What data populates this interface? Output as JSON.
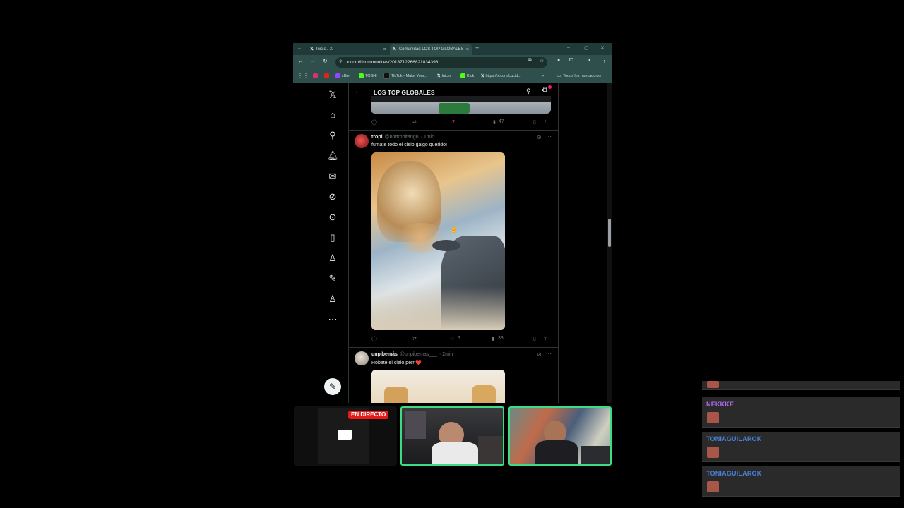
{
  "browser": {
    "tabs": [
      {
        "label": "Inicio / X",
        "close": "×"
      },
      {
        "label": "Comunidad LOS TOP GLOBALES",
        "close": "×"
      }
    ],
    "new_tab": "+",
    "url": "x.com/i/communities/2018712266821034398",
    "bookmarks": [
      "cBier",
      "TOSHI",
      "TikTok - Make Your...",
      "Inicio",
      "Kick",
      "https://x.com/Lucid..."
    ],
    "all_bookmarks": "Todos los marcadores",
    "more_bookmarks": "»"
  },
  "x": {
    "logo": "𝕏",
    "community_title": "LOS TOP GLOBALES",
    "prev_tweet": {
      "likes": "",
      "views": "47"
    },
    "tweet1": {
      "name": "tropi",
      "handle": "@nottropitango",
      "time": "· 1min",
      "text": "fumate todo el cielo galgo querido!",
      "likes": "3",
      "views": "33"
    },
    "tweet2": {
      "name": "unpibemás",
      "handle": "@unpibemas___",
      "time": "· 2min",
      "text": "Robate el cielo perri❤️"
    }
  },
  "stream": {
    "live_label": "EN DIRECTO"
  },
  "chat": {
    "messages": [
      {
        "user": "NEKKKE",
        "color": "#b46cf0"
      },
      {
        "user": "TONIAGUILAROK",
        "color": "#4a7fd6"
      },
      {
        "user": "TONIAGUILAROK",
        "color": "#4a7fd6"
      }
    ]
  },
  "colors": {
    "accent": "#f91880",
    "live": "#e91916",
    "cam_border": "#3ddc84"
  }
}
